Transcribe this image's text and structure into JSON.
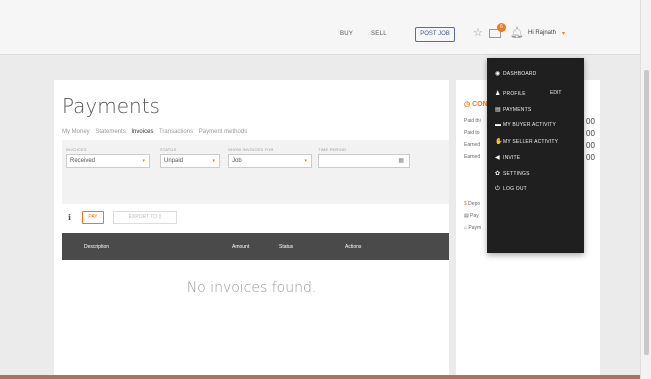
{
  "header": {
    "buy_label": "BUY",
    "sell_label": "SELL",
    "post_job_label": "POST JOB",
    "notification_count": "6",
    "user_greeting": "Hi Rajnath"
  },
  "payments": {
    "title": "Payments",
    "subnav": [
      "My Money",
      "Statements",
      "Invoices",
      "Transactions",
      "Payment methods"
    ],
    "active_subnav": "Invoices",
    "filters": {
      "invoices_label": "INVOICES",
      "invoices_value": "Received",
      "status_label": "STATUS",
      "status_value": "Unpaid",
      "show_for_label": "SHOW INVOICES FOR",
      "show_for_value": "Job",
      "time_label": "TIME PERIOD",
      "time_value": ""
    },
    "pay_label": "PAY",
    "export_label": "EXPORT TO",
    "table_headers": [
      "Description",
      "Amount",
      "Status",
      "Actions"
    ],
    "empty_message": "No invoices found."
  },
  "sidebar": {
    "title": "CON",
    "lines": [
      "Paid thi",
      "Paid to",
      "Earned",
      "Earned"
    ],
    "values": [
      "00",
      "00",
      "00",
      "00"
    ],
    "links": [
      "Depo",
      "Pay",
      "Paym"
    ]
  },
  "user_menu": {
    "items": [
      {
        "label": "DASHBOARD",
        "icon": "dashboard-icon",
        "glyph": "◉"
      },
      {
        "label": "PROFILE",
        "icon": "user-icon",
        "glyph": "♟"
      },
      {
        "label": "PAYMENTS",
        "icon": "card-icon",
        "glyph": "▤"
      },
      {
        "label": "MY BUYER ACTIVITY",
        "icon": "cart-icon",
        "glyph": "▬"
      },
      {
        "label": "MY SELLER ACTIVITY",
        "icon": "thumb-icon",
        "glyph": "✋"
      },
      {
        "label": "INVITE",
        "icon": "send-icon",
        "glyph": "◀"
      },
      {
        "label": "SETTINGS",
        "icon": "gear-icon",
        "glyph": "✿"
      },
      {
        "label": "LOG OUT",
        "icon": "power-icon",
        "glyph": "⏻"
      }
    ],
    "edit_label": "EDIT"
  },
  "colors": {
    "accent": "#f07a1a",
    "menu_bg": "#1f1f1f",
    "table_header_bg": "#4a4a4a"
  }
}
